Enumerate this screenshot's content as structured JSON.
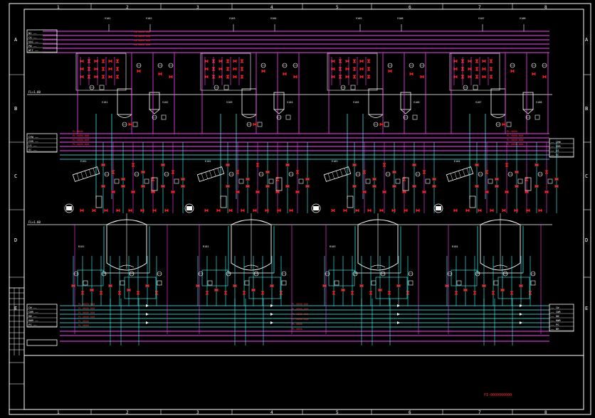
{
  "drawing": {
    "columns": [
      "1",
      "2",
      "3",
      "4",
      "5",
      "6",
      "7",
      "8"
    ],
    "rows": [
      "A",
      "B",
      "C",
      "D",
      "E"
    ],
    "top_levels": [
      "FL+1.00",
      "FL+1.00"
    ],
    "bottom_label": "PI-0000000000"
  },
  "colors": {
    "background": "#000000",
    "frame": "#ffffff",
    "process_line": "#ff40ff",
    "water_line": "#40ffff",
    "equipment": "#ffffff",
    "valve": "#ff2020",
    "instrument": "#ffff40"
  },
  "left_legend_top": [
    {
      "id": "l1",
      "text": "N2 ——"
    },
    {
      "id": "l2",
      "text": "CA ——"
    },
    {
      "id": "l3",
      "text": "VAC ——"
    },
    {
      "id": "l4",
      "text": "PW ——"
    },
    {
      "id": "l5",
      "text": "WFI ——"
    }
  ],
  "left_legend_mid": [
    {
      "id": "m1",
      "text": "CHW ——"
    },
    {
      "id": "m2",
      "text": "CHR ——"
    },
    {
      "id": "m3",
      "text": "LS ——"
    },
    {
      "id": "m4",
      "text": "SC ——"
    }
  ],
  "left_legend_bot": [
    {
      "id": "b1",
      "text": "CW ——"
    },
    {
      "id": "b2",
      "text": "CWR ——"
    },
    {
      "id": "b3",
      "text": "HW ——"
    },
    {
      "id": "b4",
      "text": "HWR ——"
    },
    {
      "id": "b5",
      "text": "PG ——"
    }
  ],
  "right_legend_mid": [
    {
      "id": "rm1",
      "text": "—— CHW"
    },
    {
      "id": "rm2",
      "text": "—— CHR"
    },
    {
      "id": "rm3",
      "text": "—— LS"
    },
    {
      "id": "rm4",
      "text": "—— SC"
    }
  ],
  "right_legend_bot": [
    {
      "id": "rb1",
      "text": "—— CW"
    },
    {
      "id": "rb2",
      "text": "—— CWR"
    },
    {
      "id": "rb3",
      "text": "—— HW"
    },
    {
      "id": "rb4",
      "text": "—— HWR"
    },
    {
      "id": "rb5",
      "text": "—— PG"
    },
    {
      "id": "rb6",
      "text": "—— DR"
    }
  ],
  "sections": [
    {
      "top_tag_a": "V101",
      "top_tag_b": "V102",
      "reactor_tag": "R101",
      "hx_tag": "E101"
    },
    {
      "top_tag_a": "V103",
      "top_tag_b": "V104",
      "reactor_tag": "R102",
      "hx_tag": "E102"
    },
    {
      "top_tag_a": "V105",
      "top_tag_b": "V106",
      "reactor_tag": "R103",
      "hx_tag": "E103"
    },
    {
      "top_tag_a": "V107",
      "top_tag_b": "V108",
      "reactor_tag": "R104",
      "hx_tag": "E104"
    }
  ],
  "tags": {
    "top_line_labels": [
      "PN-0000-000",
      "PN-0000-000",
      "PN-0000-000",
      "PN-0000-000"
    ],
    "mid_line_labels": [
      "PL-0000",
      "PL-0000-000",
      "PL-0000-000",
      "PL-0000-000"
    ],
    "bottom_line_labels": [
      "PL-0000-000",
      "PL-0000-000",
      "PL-0000-000",
      "PL-0000-000",
      "PL-0000",
      "PL-0000"
    ]
  }
}
